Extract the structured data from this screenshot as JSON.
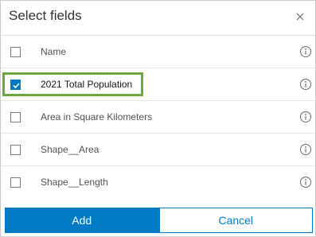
{
  "dialog": {
    "title": "Select fields",
    "close_icon": "close-icon",
    "info_icon": "info-icon"
  },
  "fields": [
    {
      "label": "Name",
      "checked": false
    },
    {
      "label": "2021 Total Population",
      "checked": true
    },
    {
      "label": "Area in Square Kilometers",
      "checked": false
    },
    {
      "label": "Shape__Area",
      "checked": false
    },
    {
      "label": "Shape__Length",
      "checked": false
    }
  ],
  "footer": {
    "add_label": "Add",
    "cancel_label": "Cancel"
  },
  "colors": {
    "accent": "#007ac2",
    "highlight": "#6ca83b"
  }
}
